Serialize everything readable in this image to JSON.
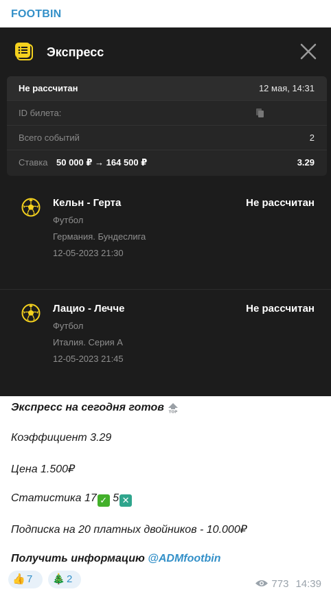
{
  "channel": {
    "name": "FOOTBIN"
  },
  "slip": {
    "title": "Экспресс",
    "status": "Не рассчитан",
    "datetime": "12 мая, 14:31",
    "ticket_id_label": "ID билета:",
    "total_events_label": "Всего событий",
    "total_events_value": "2",
    "stake_label": "Ставка",
    "stake_amounts": "50 000 ₽ → 164 500 ₽",
    "odds": "3.29",
    "events": [
      {
        "name": "Кельн - Герта",
        "status": "Не рассчитан",
        "sport": "Футбол",
        "league": "Германия. Бундеслига",
        "datetime": "12-05-2023 21:30"
      },
      {
        "name": "Лацио - Лечче",
        "status": "Не рассчитан",
        "sport": "Футбол",
        "league": "Италия. Серия А",
        "datetime": "12-05-2023 21:45"
      }
    ]
  },
  "message": {
    "line1": "Экспресс на сегодня готов",
    "line2": "Коэффициент 3.29",
    "line3": "Цена 1.500₽",
    "line4_prefix": "Статистика 17",
    "line4_mid": " 5",
    "line5": "Подписка на 20 платных двойников - 10.000₽",
    "line6": "Получить информацию ",
    "mention": "@ADMfootbin"
  },
  "reactions": [
    {
      "emoji": "👍",
      "count": "7",
      "icon": "thumbs-up-icon"
    },
    {
      "emoji": "🎄",
      "count": "2",
      "icon": "christmas-tree-icon"
    }
  ],
  "footer": {
    "views": "773",
    "time": "14:39"
  },
  "colors": {
    "accent": "#3390c8",
    "slip_bg": "#1c1c1c",
    "ball": "#f5d21e"
  }
}
